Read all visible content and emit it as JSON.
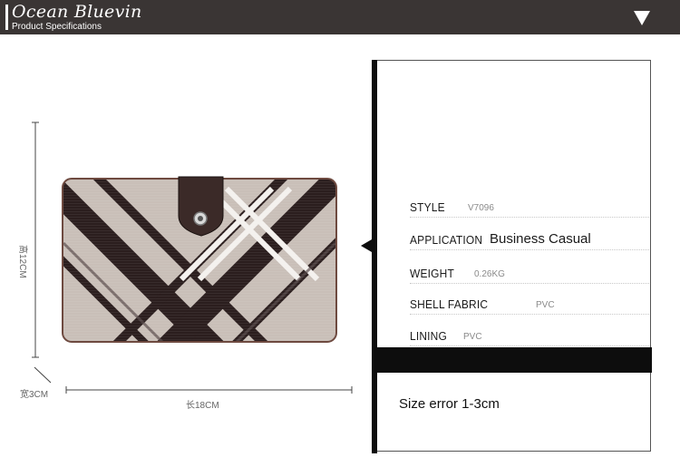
{
  "header": {
    "brand": "Ocean Bluevin",
    "subtitle": "Product Specifications",
    "toggle_icon": "triangle-down-icon"
  },
  "product_image": {
    "height_label": "高12CM",
    "depth_label": "宽3CM",
    "length_label": "长18CM"
  },
  "specs": {
    "style": {
      "label": "STYLE",
      "value": "V7096"
    },
    "application": {
      "label": "APPLICATION",
      "value": "Business Casual"
    },
    "weight": {
      "label": "WEIGHT",
      "value": "0.26KG"
    },
    "shell_fabric": {
      "label": "SHELL FABRIC",
      "value": "PVC"
    },
    "lining": {
      "label": "LINING",
      "value": "PVC"
    }
  },
  "note": "Size error 1-3cm",
  "colors": {
    "header_bg": "#3a3534",
    "plaid_light": "#c9bfb8",
    "plaid_dark": "#2b1e1e",
    "accent_black": "#0d0d0d"
  }
}
